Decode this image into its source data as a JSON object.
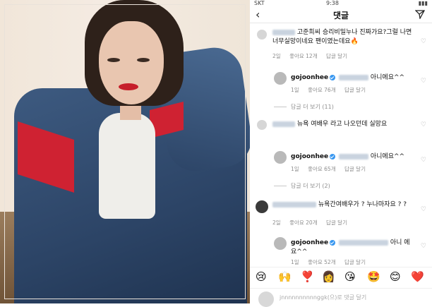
{
  "status": {
    "carrier": "SKT",
    "time": "9:38",
    "battery": ""
  },
  "header": {
    "title": "댓글"
  },
  "comments": [
    {
      "text": "고준희씨 승리비밀누나 진짜가요?그럴 나면너무실망이네요 팬이였는데요🔥",
      "age": "2일",
      "likes": "좋아요 12개",
      "reply": "답글 달기"
    },
    {
      "user": "gojoonhee",
      "text": "아니에요^^",
      "age": "1일",
      "likes": "좋아요 76개",
      "reply": "답글 달기",
      "more": "답글 더 보기 (11)"
    },
    {
      "text": "뉴욕 여배우 라고 나오던데 실망요",
      "age": "",
      "likes": "",
      "reply": ""
    },
    {
      "user": "gojoonhee",
      "text": "아니에요^^",
      "age": "1일",
      "likes": "좋아요 65개",
      "reply": "답글 달기",
      "more": "답글 더 보기 (2)"
    },
    {
      "text": "뉴욕간여배우가 ? 누나마자요 ? ?",
      "age": "2일",
      "likes": "좋아요 20개",
      "reply": "답글 달기"
    },
    {
      "user": "gojoonhee",
      "text": "아니 에요^^",
      "age": "1일",
      "likes": "좋아요 52개",
      "reply": "답글 달기"
    }
  ],
  "emojis": [
    "😢",
    "🙌",
    "❣️",
    "👩",
    "😘",
    "🤩",
    "😊",
    "❤️"
  ],
  "input": {
    "placeholder": "jnnnnnnnnnnggk(으)로 댓글 달기"
  },
  "icons": {
    "back": "chevron-left-icon",
    "send": "paper-plane-icon",
    "heart": "heart-outline-icon"
  }
}
